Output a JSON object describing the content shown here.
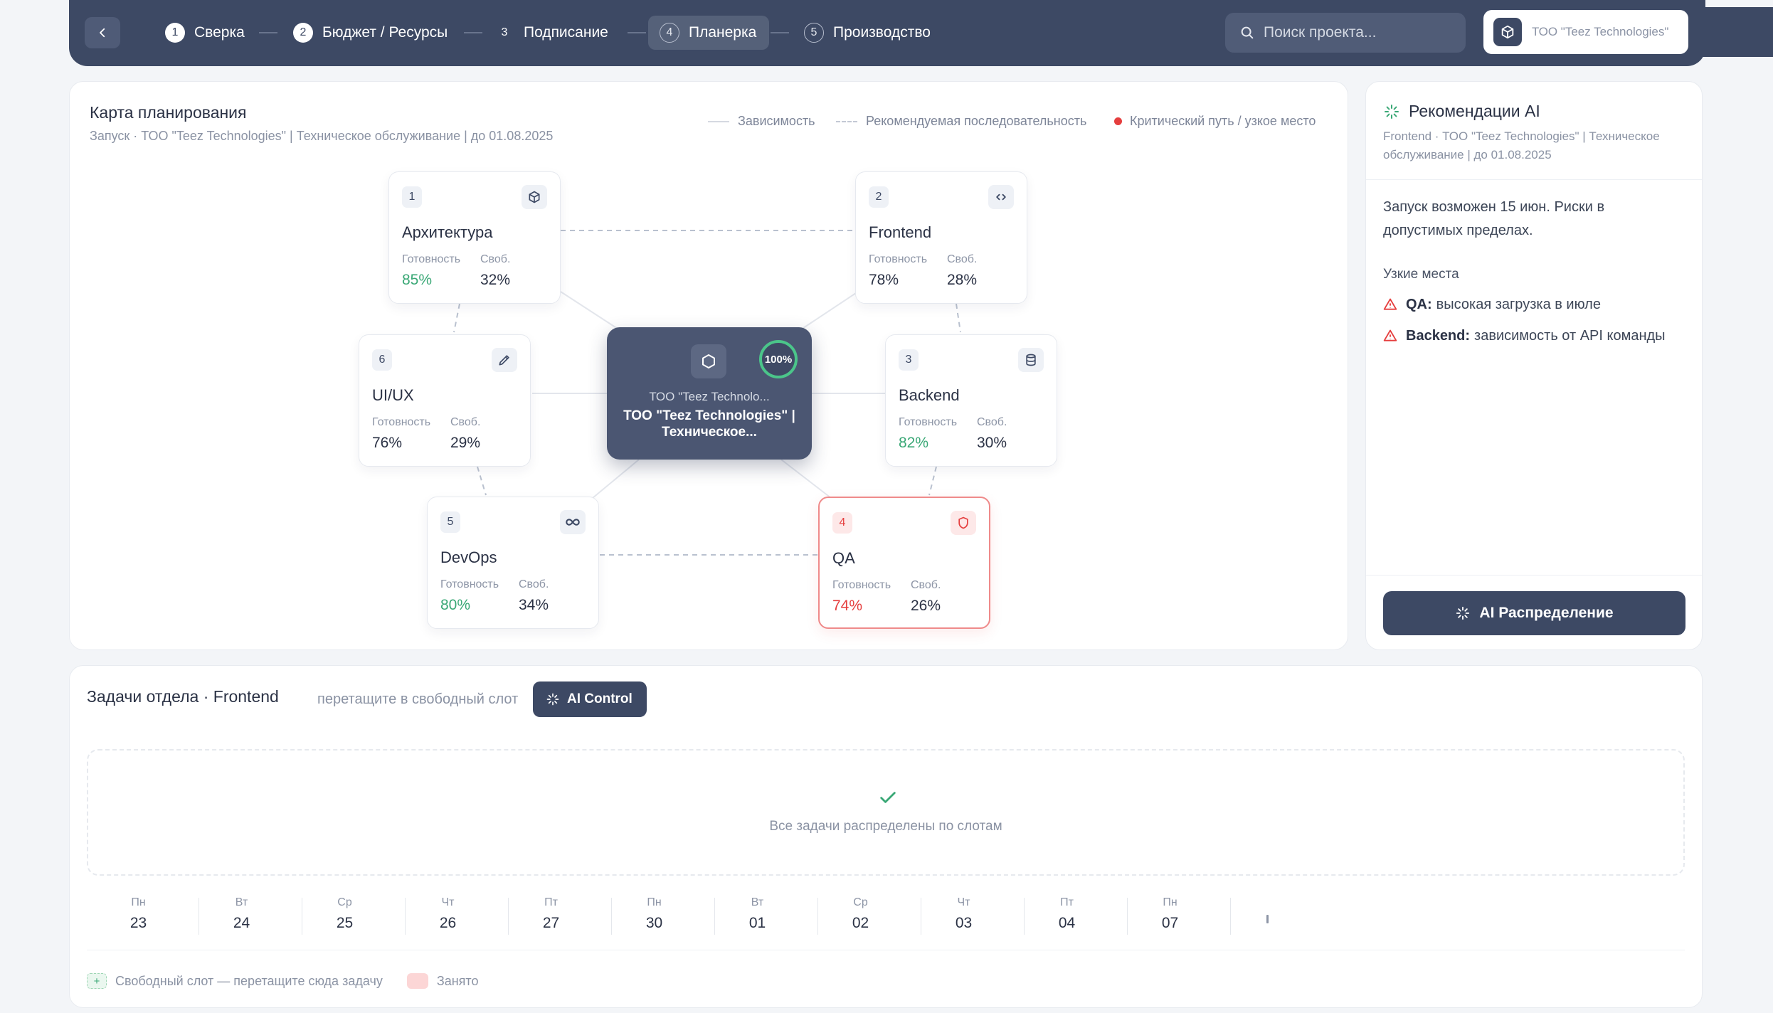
{
  "topbar": {
    "steps": [
      {
        "num": "1",
        "label": "Сверка"
      },
      {
        "num": "2",
        "label": "Бюджет / Ресурсы"
      },
      {
        "num": "3",
        "label": "Подписание"
      },
      {
        "num": "4",
        "label": "Планерка"
      },
      {
        "num": "5",
        "label": "Производство"
      }
    ],
    "active_step": "4",
    "search_placeholder": "Поиск проекта...",
    "company": "ТОО \"Teez Technologies\""
  },
  "map": {
    "title": "Карта планирования",
    "subtitle": "Запуск · ТОО \"Teez Technologies\" | Техническое обслуживание | до 01.08.2025",
    "legend": {
      "dependency": "Зависимость",
      "recommended": "Рекомендуемая последовательность",
      "critical": "Критический путь / узкое место"
    },
    "readiness_label": "Готовность",
    "free_label": "Своб.",
    "center": {
      "percent": "100%",
      "company": "ТОО \"Teez Technolo...",
      "title": "ТОО \"Teez Technologies\" | Техническое..."
    },
    "nodes": [
      {
        "num": "1",
        "name": "Архитектура",
        "readiness": "85%",
        "free": "32%",
        "icon": "cube-icon"
      },
      {
        "num": "2",
        "name": "Frontend",
        "readiness": "78%",
        "free": "28%",
        "icon": "code-icon"
      },
      {
        "num": "3",
        "name": "Backend",
        "readiness": "82%",
        "free": "30%",
        "icon": "database-icon"
      },
      {
        "num": "4",
        "name": "QA",
        "readiness": "74%",
        "free": "26%",
        "icon": "shield-icon",
        "critical": true
      },
      {
        "num": "5",
        "name": "DevOps",
        "readiness": "80%",
        "free": "34%",
        "icon": "infinity-icon"
      },
      {
        "num": "6",
        "name": "UI/UX",
        "readiness": "76%",
        "free": "29%",
        "icon": "pencil-icon"
      }
    ]
  },
  "ai": {
    "title": "Рекомендации AI",
    "subtitle": "Frontend · ТОО \"Teez Technologies\" | Техническое обслуживание | до 01.08.2025",
    "summary": "Запуск возможен 15 июн. Риски в допустимых пределах.",
    "bottlenecks_title": "Узкие места",
    "bottlenecks": [
      {
        "key": "QA:",
        "text": "высокая загрузка в июле"
      },
      {
        "key": "Backend:",
        "text": "зависимость от API команды"
      }
    ],
    "button": "AI Распределение"
  },
  "tasks": {
    "title": "Задачи отдела · Frontend",
    "hint": "перетащите в свободный слот",
    "ai_control": "AI Control",
    "empty_text": "Все задачи распределены по слотам",
    "days": [
      {
        "w": "Пн",
        "n": "23"
      },
      {
        "w": "Вт",
        "n": "24"
      },
      {
        "w": "Ср",
        "n": "25"
      },
      {
        "w": "Чт",
        "n": "26"
      },
      {
        "w": "Пт",
        "n": "27"
      },
      {
        "w": "Пн",
        "n": "30"
      },
      {
        "w": "Вт",
        "n": "01"
      },
      {
        "w": "Ср",
        "n": "02"
      },
      {
        "w": "Чт",
        "n": "03"
      },
      {
        "w": "Пт",
        "n": "04"
      },
      {
        "w": "Пн",
        "n": "07"
      }
    ],
    "legend_free": "Свободный слот — перетащите сюда задачу",
    "legend_busy": "Занято"
  },
  "colors": {
    "primary": "#3d4964",
    "success": "#3aa876",
    "danger": "#e53e3e"
  }
}
